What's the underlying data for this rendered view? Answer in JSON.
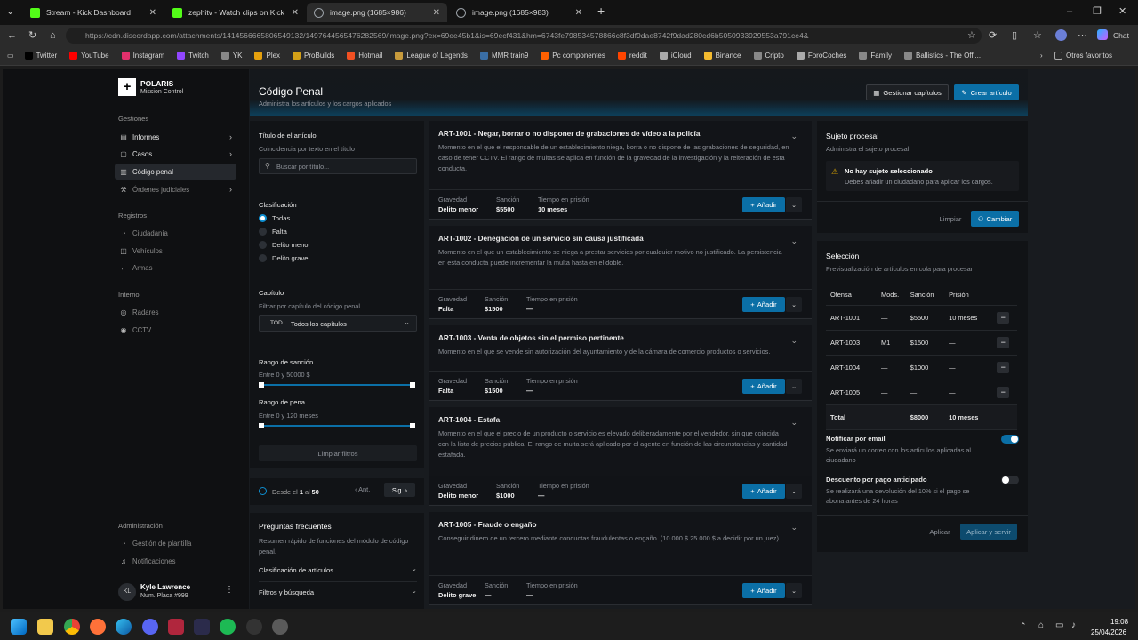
{
  "browser": {
    "tabs": [
      {
        "title": "Stream - Kick Dashboard",
        "color": "#53fc18"
      },
      {
        "title": "zephitv - Watch clips on Kick",
        "color": "#53fc18"
      },
      {
        "title": "image.png (1685×986)",
        "color": "#9aa0a6"
      },
      {
        "title": "image.png (1685×983)",
        "color": "#9aa0a6"
      }
    ],
    "url": "https://cdn.discordapp.com/attachments/1414566665806549132/1497644565476282569/image.png?ex=69ee45b1&is=69ecf431&hm=6743fe798534578866c8f3df9dae8742f9dad280cd6b5050933929553a791ce4&",
    "bookmarks": [
      {
        "label": "Twitter",
        "color": "#000"
      },
      {
        "label": "YouTube",
        "color": "#ff0000"
      },
      {
        "label": "Instagram",
        "color": "#e1306c"
      },
      {
        "label": "Twitch",
        "color": "#9146ff"
      },
      {
        "label": "YK",
        "color": "#888"
      },
      {
        "label": "Plex",
        "color": "#e5a00d"
      },
      {
        "label": "ProBuilds",
        "color": "#d4a017"
      },
      {
        "label": "Hotmail",
        "color": "#f25022"
      },
      {
        "label": "League of Legends",
        "color": "#c89b3c"
      },
      {
        "label": "MMR train9",
        "color": "#3a6ea5"
      },
      {
        "label": "Pc componentes",
        "color": "#ff6000"
      },
      {
        "label": "reddit",
        "color": "#ff4500"
      },
      {
        "label": "iCloud",
        "color": "#aaa"
      },
      {
        "label": "Binance",
        "color": "#f3ba2f"
      },
      {
        "label": "Cripto",
        "color": "#888"
      },
      {
        "label": "ForoCoches",
        "color": "#aaa"
      },
      {
        "label": "Family",
        "color": "#888"
      },
      {
        "label": "Ballistics - The Offi...",
        "color": "#888"
      }
    ],
    "other_favorites": "Otros favoritos",
    "chat": "Chat"
  },
  "sidebar": {
    "brand": "POLARIS",
    "brand_sub": "Mission Control",
    "sections": {
      "gestiones": "Gestiones",
      "registros": "Registros",
      "interno": "Interno",
      "admin": "Administración"
    },
    "items": {
      "informes": "Informes",
      "casos": "Casos",
      "codigo": "Código penal",
      "ordenes": "Órdenes judiciales",
      "ciudadania": "Ciudadanía",
      "vehiculos": "Vehículos",
      "armas": "Armas",
      "radares": "Radares",
      "cctv": "CCTV",
      "plantilla": "Gestión de plantilla",
      "notificaciones": "Notificaciones"
    },
    "user": {
      "initials": "KL",
      "name": "Kyle Lawrence",
      "plate": "Num. Placa #999"
    }
  },
  "header": {
    "title": "Código Penal",
    "subtitle": "Administra los artículos y los cargos aplicados",
    "manage": "Gestionar capítulos",
    "create": "Crear artículo"
  },
  "filters": {
    "title_label": "Título de el artículo",
    "title_sub": "Coincidencia por texto en el título",
    "search_placeholder": "Buscar por título...",
    "class_label": "Clasificación",
    "options": [
      "Todas",
      "Falta",
      "Delito menor",
      "Delito grave"
    ],
    "chapter_label": "Capítulo",
    "chapter_sub": "Filtrar por capítulo del código penal",
    "chapter_code": "TOD",
    "chapter_value": "Todos los capítulos",
    "sanction_label": "Rango de sanción",
    "sanction_sub": "Entre 0 y 50000 $",
    "sentence_label": "Rango de pena",
    "sentence_sub": "Entre 0 y 120 meses",
    "clear": "Limpiar filtros"
  },
  "pagination": {
    "from": "Desde el",
    "n1": "1",
    "al": "al",
    "n2": "50",
    "prev": "Ant.",
    "next": "Sig."
  },
  "faq": {
    "title": "Preguntas frecuentes",
    "sub": "Resumen rápido de funciones del módulo de código penal.",
    "q1": "Clasificación de artículos",
    "q2": "Filtros y búsqueda"
  },
  "articles": [
    {
      "title": "ART-1001 - Negar, borrar o no disponer de grabaciones de vídeo a la policía",
      "desc": "Momento en el que el responsable de un establecimiento niega, borra o no dispone de las grabaciones de seguridad, en caso de tener CCTV. El rango de multas se aplica en función de la gravedad de la investigación y la reiteración de esta conducta.",
      "gravedad": "Delito menor",
      "sancion": "$5500",
      "tiempo": "10 meses"
    },
    {
      "title": "ART-1002 - Denegación de un servicio sin causa justificada",
      "desc": "Momento en el que un establecimiento se niega a prestar servicios por cualquier motivo no justificado. La persistencia en esta conducta puede incrementar la multa hasta en el doble.",
      "gravedad": "Falta",
      "sancion": "$1500",
      "tiempo": "—"
    },
    {
      "title": "ART-1003 - Venta de objetos sin el permiso pertinente",
      "desc": "Momento en el que se vende sin autorización del ayuntamiento y de la cámara de comercio productos o servicios.",
      "gravedad": "Falta",
      "sancion": "$1500",
      "tiempo": "—"
    },
    {
      "title": "ART-1004 - Estafa",
      "desc": "Momento en el que el precio de un producto o servicio es elevado deliberadamente por el vendedor, sin que coincida con la lista de precios pública. El rango de multa será aplicado por el agente en función de las circunstancias y cantidad estafada.",
      "gravedad": "Delito menor",
      "sancion": "$1000",
      "tiempo": "—"
    },
    {
      "title": "ART-1005 - Fraude o engaño",
      "desc": "Conseguir dinero de un tercero mediante conductas fraudulentas o engaño. (10.000 $ 25.000 $ a decidir por un juez)",
      "gravedad": "Delito grave",
      "sancion": "—",
      "tiempo": "—"
    }
  ],
  "meta_labels": {
    "gravedad": "Gravedad",
    "sancion": "Sanción",
    "tiempo": "Tiempo en prisión",
    "add": "Añadir"
  },
  "subject": {
    "title": "Sujeto procesal",
    "sub": "Administra el sujeto procesal",
    "warn_title": "No hay sujeto seleccionado",
    "warn_sub": "Debes añadir un ciudadano para aplicar los cargos.",
    "clear": "Limpiar",
    "change": "Cambiar"
  },
  "selection": {
    "title": "Selección",
    "sub": "Previsualización de artículos en cola para procesar",
    "headers": [
      "Ofensa",
      "Mods.",
      "Sanción",
      "Prisión"
    ],
    "rows": [
      [
        "ART-1001",
        "—",
        "$5500",
        "10 meses"
      ],
      [
        "ART-1003",
        "M1",
        "$1500",
        "—"
      ],
      [
        "ART-1004",
        "—",
        "$1000",
        "—"
      ],
      [
        "ART-1005",
        "—",
        "—",
        "—"
      ]
    ],
    "total": [
      "Total",
      "",
      "$8000",
      "10 meses"
    ],
    "notify_label": "Notificar por email",
    "notify_sub": "Se enviará un correo con los artículos aplicadas al ciudadano",
    "notify_on": true,
    "discount_label": "Descuento por pago anticipado",
    "discount_sub": "Se realizará una devolución del 10% si el pago se abona antes de 24 horas",
    "discount_on": false,
    "apply": "Aplicar",
    "apply_serve": "Aplicar y servir"
  },
  "taskbar": {
    "time": "19:08",
    "date": "25/04/2026"
  }
}
